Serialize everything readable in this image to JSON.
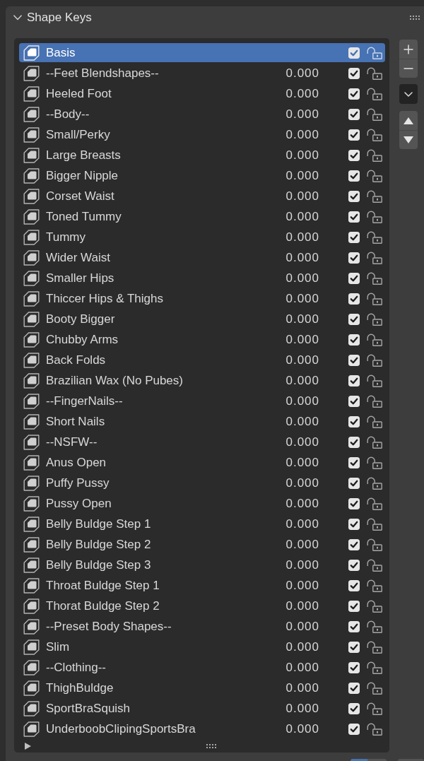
{
  "panel": {
    "title": "Shape Keys",
    "expanded": true
  },
  "shape_keys": [
    {
      "name": "Basis",
      "selected": true,
      "checked": true,
      "locked": false
    },
    {
      "name": "--Feet Blendshapes--",
      "value": "0.000",
      "selected": false,
      "checked": true,
      "locked": false
    },
    {
      "name": "Heeled Foot",
      "value": "0.000",
      "selected": false,
      "checked": true,
      "locked": false
    },
    {
      "name": "--Body--",
      "value": "0.000",
      "selected": false,
      "checked": true,
      "locked": false
    },
    {
      "name": "Small/Perky",
      "value": "0.000",
      "selected": false,
      "checked": true,
      "locked": false
    },
    {
      "name": "Large Breasts",
      "value": "0.000",
      "selected": false,
      "checked": true,
      "locked": false
    },
    {
      "name": "Bigger Nipple",
      "value": "0.000",
      "selected": false,
      "checked": true,
      "locked": false
    },
    {
      "name": "Corset Waist",
      "value": "0.000",
      "selected": false,
      "checked": true,
      "locked": false
    },
    {
      "name": "Toned Tummy",
      "value": "0.000",
      "selected": false,
      "checked": true,
      "locked": false
    },
    {
      "name": "Tummy",
      "value": "0.000",
      "selected": false,
      "checked": true,
      "locked": false
    },
    {
      "name": "Wider Waist",
      "value": "0.000",
      "selected": false,
      "checked": true,
      "locked": false
    },
    {
      "name": "Smaller Hips",
      "value": "0.000",
      "selected": false,
      "checked": true,
      "locked": false
    },
    {
      "name": "Thiccer Hips & Thighs",
      "value": "0.000",
      "selected": false,
      "checked": true,
      "locked": false
    },
    {
      "name": "Booty Bigger",
      "value": "0.000",
      "selected": false,
      "checked": true,
      "locked": false
    },
    {
      "name": "Chubby Arms",
      "value": "0.000",
      "selected": false,
      "checked": true,
      "locked": false
    },
    {
      "name": "Back Folds",
      "value": "0.000",
      "selected": false,
      "checked": true,
      "locked": false
    },
    {
      "name": "Brazilian Wax (No Pubes)",
      "value": "0.000",
      "selected": false,
      "checked": true,
      "locked": false
    },
    {
      "name": "--FingerNails--",
      "value": "0.000",
      "selected": false,
      "checked": true,
      "locked": false
    },
    {
      "name": "Short Nails",
      "value": "0.000",
      "selected": false,
      "checked": true,
      "locked": false
    },
    {
      "name": "--NSFW--",
      "value": "0.000",
      "selected": false,
      "checked": true,
      "locked": false
    },
    {
      "name": "Anus Open",
      "value": "0.000",
      "selected": false,
      "checked": true,
      "locked": false
    },
    {
      "name": "Puffy Pussy",
      "value": "0.000",
      "selected": false,
      "checked": true,
      "locked": false
    },
    {
      "name": "Pussy Open",
      "value": "0.000",
      "selected": false,
      "checked": true,
      "locked": false
    },
    {
      "name": "Belly Buldge Step 1",
      "value": "0.000",
      "selected": false,
      "checked": true,
      "locked": false
    },
    {
      "name": "Belly Buldge Step 2",
      "value": "0.000",
      "selected": false,
      "checked": true,
      "locked": false
    },
    {
      "name": "Belly Buldge Step 3",
      "value": "0.000",
      "selected": false,
      "checked": true,
      "locked": false
    },
    {
      "name": "Throat Buldge Step 1",
      "value": "0.000",
      "selected": false,
      "checked": true,
      "locked": false
    },
    {
      "name": "Thorat Buldge Step 2",
      "value": "0.000",
      "selected": false,
      "checked": true,
      "locked": false
    },
    {
      "name": "--Preset Body Shapes--",
      "value": "0.000",
      "selected": false,
      "checked": true,
      "locked": false
    },
    {
      "name": "Slim",
      "value": "0.000",
      "selected": false,
      "checked": true,
      "locked": false
    },
    {
      "name": "--Clothing--",
      "value": "0.000",
      "selected": false,
      "checked": true,
      "locked": false
    },
    {
      "name": "ThighBuldge",
      "value": "0.000",
      "selected": false,
      "checked": true,
      "locked": false
    },
    {
      "name": "SportBraSquish",
      "value": "0.000",
      "selected": false,
      "checked": true,
      "locked": false
    },
    {
      "name": "UnderboobClipingSportsBra",
      "value": "0.000",
      "selected": false,
      "checked": true,
      "locked": false
    }
  ],
  "list_footer": {
    "expanded": false
  },
  "bottom_controls": [
    {
      "kind": "segment",
      "selected": true
    },
    {
      "kind": "segment",
      "selected": false
    },
    {
      "kind": "button",
      "selected": false
    }
  ]
}
